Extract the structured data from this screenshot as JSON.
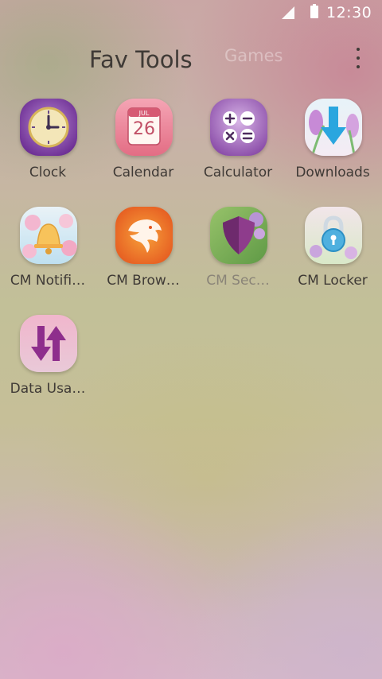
{
  "status": {
    "time": "12:30",
    "signal_icon": "signal-icon",
    "battery_icon": "battery-icon"
  },
  "tabs": {
    "active": "Fav Tools",
    "other": "Games"
  },
  "apps": [
    {
      "label": "Clock",
      "icon": "clock-icon"
    },
    {
      "label": "Calendar",
      "icon": "calendar-icon",
      "month": "JUL",
      "day": "26"
    },
    {
      "label": "Calculator",
      "icon": "calculator-icon"
    },
    {
      "label": "Downloads",
      "icon": "download-icon"
    },
    {
      "label": "CM Notifi…",
      "icon": "bell-icon"
    },
    {
      "label": "CM Brow…",
      "icon": "browser-icon"
    },
    {
      "label": "CM Sec…",
      "icon": "shield-icon"
    },
    {
      "label": "CM Locker",
      "icon": "lock-icon"
    },
    {
      "label": "Data Usa…",
      "icon": "data-usage-icon"
    }
  ],
  "colors": {
    "text": "#3f3a36",
    "accent_purple": "#8e3c8c",
    "download_blue": "#2aa6df"
  }
}
